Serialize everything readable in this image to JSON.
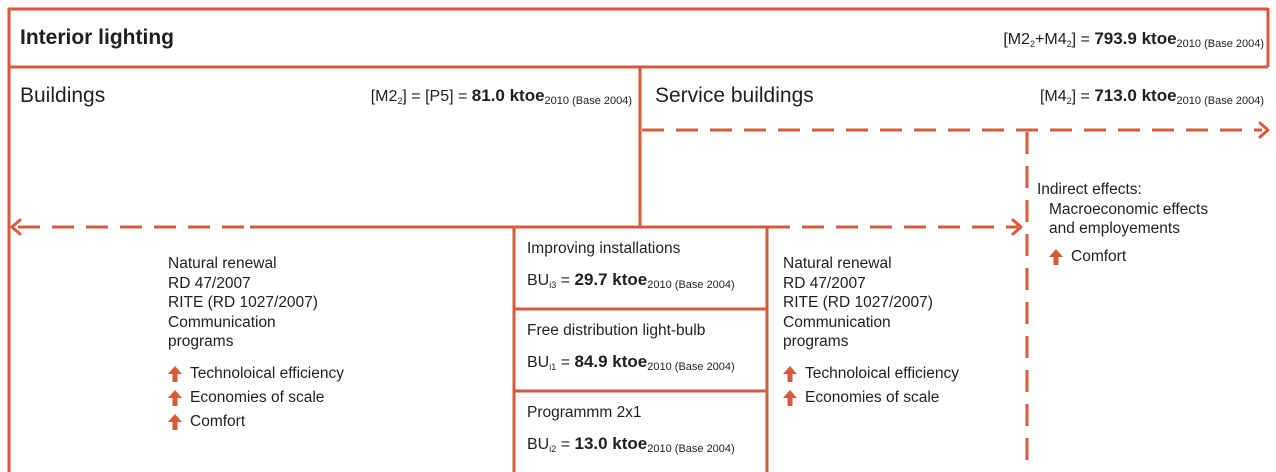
{
  "colors": {
    "accent": "#d9593b",
    "text": "#231f20"
  },
  "header": {
    "title": "Interior lighting",
    "formula_lhs": "[M2",
    "sub1": "2",
    "plus": "+M4",
    "sub2": "2",
    "close_eq": "] = ",
    "value": "793.9 ktoe",
    "subscript": "2010 (Base 2004)"
  },
  "buildings": {
    "label": "Buildings",
    "formula_lhs": "[M2",
    "sub": "2",
    "eq": "] = [P5] = ",
    "value": "81.0 ktoe",
    "subscript": "2010 (Base 2004)"
  },
  "service": {
    "label": "Service buildings",
    "formula_lhs": "[M4",
    "sub": "2",
    "eq": "] = ",
    "value": "713.0 ktoe",
    "subscript": "2010 (Base 2004)"
  },
  "left_list": {
    "lines": [
      "Natural renewal",
      "RD 47/2007",
      "RITE (RD 1027/2007)",
      "Communication",
      "programs"
    ],
    "effects": [
      "Technoloical efficiency",
      "Economies of scale",
      "Comfort"
    ]
  },
  "middle": {
    "boxes": [
      {
        "title": "Improving installations",
        "prefix": "BU",
        "sub": "i3",
        "eq": " = ",
        "value": "29.7 ktoe",
        "subscript": "2010 (Base 2004)"
      },
      {
        "title": "Free distribution light-bulb",
        "prefix": "BU",
        "sub": "i1",
        "eq": " = ",
        "value": "84.9 ktoe",
        "subscript": "2010 (Base 2004)"
      },
      {
        "title": "Programmm 2x1",
        "prefix": "BU",
        "sub": "i2",
        "eq": " = ",
        "value": "13.0 ktoe",
        "subscript": "2010 (Base 2004)"
      }
    ]
  },
  "right_list": {
    "lines": [
      "Natural renewal",
      "RD 47/2007",
      "RITE (RD 1027/2007)",
      "Communication",
      "programs"
    ],
    "effects": [
      "Technoloical efficiency",
      "Economies of scale"
    ]
  },
  "indirect": {
    "lines": [
      "Indirect effects:",
      "Macroeconomic effects",
      "and employements"
    ],
    "effects": [
      "Comfort"
    ]
  }
}
